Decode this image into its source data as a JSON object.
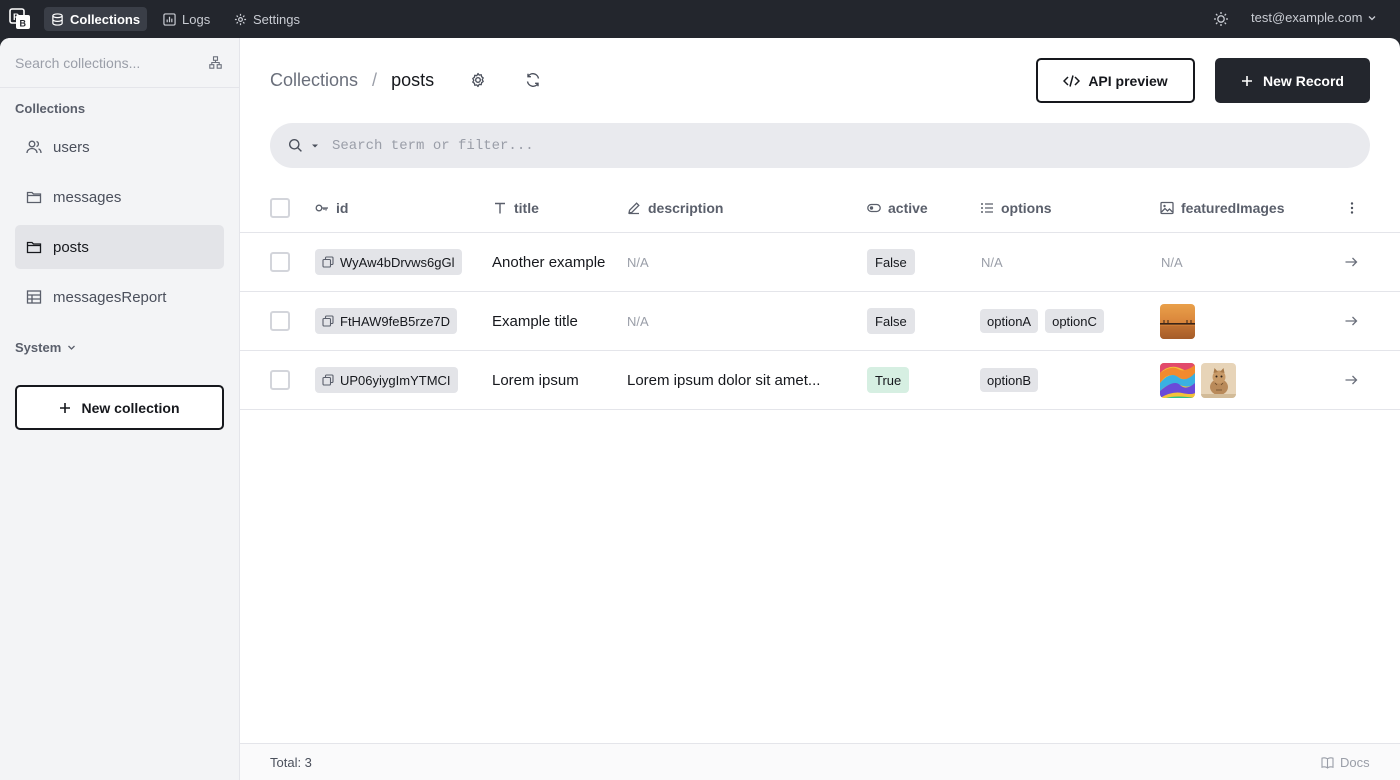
{
  "topnav": {
    "items": [
      {
        "label": "Collections",
        "icon": "database-icon",
        "active": true
      },
      {
        "label": "Logs",
        "icon": "chart-icon",
        "active": false
      },
      {
        "label": "Settings",
        "icon": "gear-icon",
        "active": false
      }
    ],
    "user_email": "test@example.com"
  },
  "sidebar": {
    "search_placeholder": "Search collections...",
    "section_label": "Collections",
    "items": [
      {
        "label": "users",
        "icon": "users-icon"
      },
      {
        "label": "messages",
        "icon": "folder-icon"
      },
      {
        "label": "posts",
        "icon": "folder-icon",
        "active": true
      },
      {
        "label": "messagesReport",
        "icon": "table-icon"
      }
    ],
    "system_label": "System",
    "new_collection_label": "New collection"
  },
  "header": {
    "crumb_root": "Collections",
    "crumb_separator": "/",
    "crumb_current": "posts",
    "api_preview_label": "API preview",
    "new_record_label": "New Record"
  },
  "search": {
    "placeholder": "Search term or filter..."
  },
  "table": {
    "columns": [
      {
        "label": "id",
        "icon": "key-icon"
      },
      {
        "label": "title",
        "icon": "text-icon"
      },
      {
        "label": "description",
        "icon": "pencil-icon"
      },
      {
        "label": "active",
        "icon": "toggle-icon"
      },
      {
        "label": "options",
        "icon": "list-icon"
      },
      {
        "label": "featuredImages",
        "icon": "image-icon"
      }
    ],
    "rows": [
      {
        "id": "WyAw4bDrvws6gGl",
        "title": "Another example",
        "description": "N/A",
        "active": "False",
        "options": [],
        "options_empty": "N/A",
        "images": [],
        "images_empty": "N/A"
      },
      {
        "id": "FtHAW9feB5rze7D",
        "title": "Example title",
        "description": "N/A",
        "active": "False",
        "options": [
          "optionA",
          "optionC"
        ],
        "images": [
          "sunset-pier"
        ]
      },
      {
        "id": "UP06yiygImYTMCI",
        "title": "Lorem ipsum",
        "description": "Lorem ipsum dolor sit amet...",
        "active": "True",
        "options": [
          "optionB"
        ],
        "images": [
          "rainbow-fabric",
          "kitten"
        ]
      }
    ]
  },
  "footer": {
    "total_label": "Total: 3",
    "docs_label": "Docs"
  }
}
